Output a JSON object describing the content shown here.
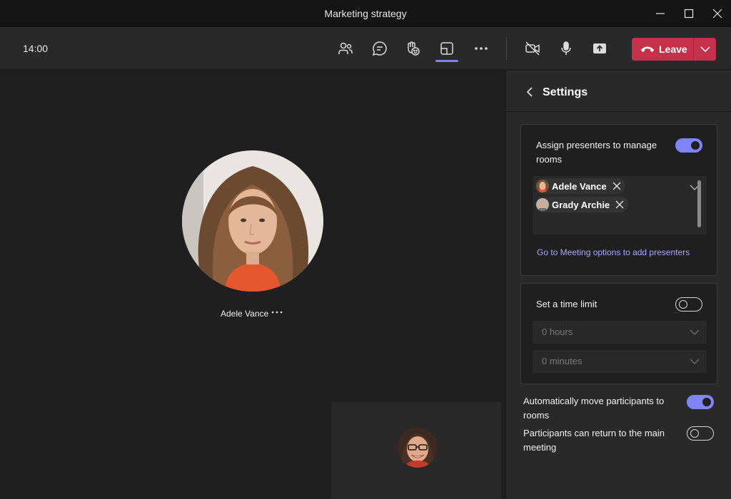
{
  "window": {
    "title": "Marketing strategy"
  },
  "toolbar": {
    "clock": "14:00",
    "leave_label": "Leave",
    "icons": [
      "people-icon",
      "chat-icon",
      "reactions-icon",
      "rooms-icon",
      "more-icon",
      "camera-off-icon",
      "microphone-icon",
      "share-icon"
    ],
    "active_icon": "rooms-icon",
    "accent": "#7f85f5",
    "leave_color": "#c4314b"
  },
  "stage": {
    "participant_name": "Adele Vance",
    "more_glyph": "···"
  },
  "settings": {
    "title": "Settings",
    "assign_presenters_label": "Assign presenters to manage rooms",
    "assign_presenters_on": true,
    "presenters": [
      {
        "name": "Adele Vance"
      },
      {
        "name": "Grady Archie"
      }
    ],
    "meeting_options_link": "Go to Meeting options to add presenters",
    "time_limit_label": "Set a time limit",
    "time_limit_on": false,
    "hours_value": "0 hours",
    "minutes_value": "0 minutes",
    "auto_move_label": "Automatically move participants to rooms",
    "auto_move_on": true,
    "return_label": "Participants can return to the main meeting",
    "return_on": false
  }
}
